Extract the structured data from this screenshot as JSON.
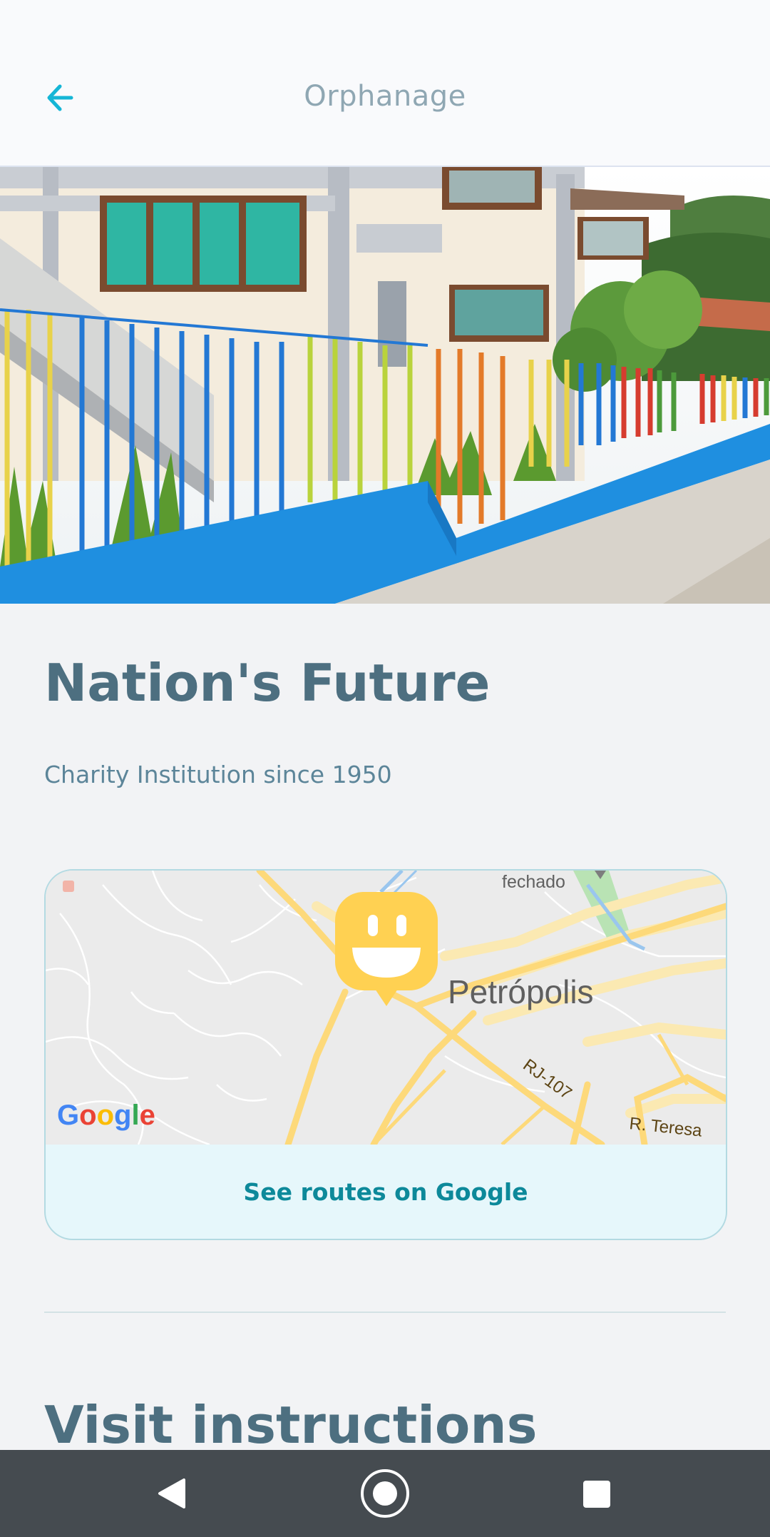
{
  "header": {
    "title": "Orphanage"
  },
  "place": {
    "name": "Nation's Future",
    "description": "Charity Institution since 1950"
  },
  "map": {
    "labels": {
      "city": "Petrópolis",
      "road": "RJ-107",
      "street": "R. Teresa",
      "poi": "fechado"
    },
    "google_logo": "Google",
    "routes_label": "See routes on Google"
  },
  "sections": {
    "visit_title": "Visit instructions"
  },
  "colors": {
    "accent": "#15b6d6",
    "title": "#4d6f80",
    "marker": "#ffd152"
  }
}
